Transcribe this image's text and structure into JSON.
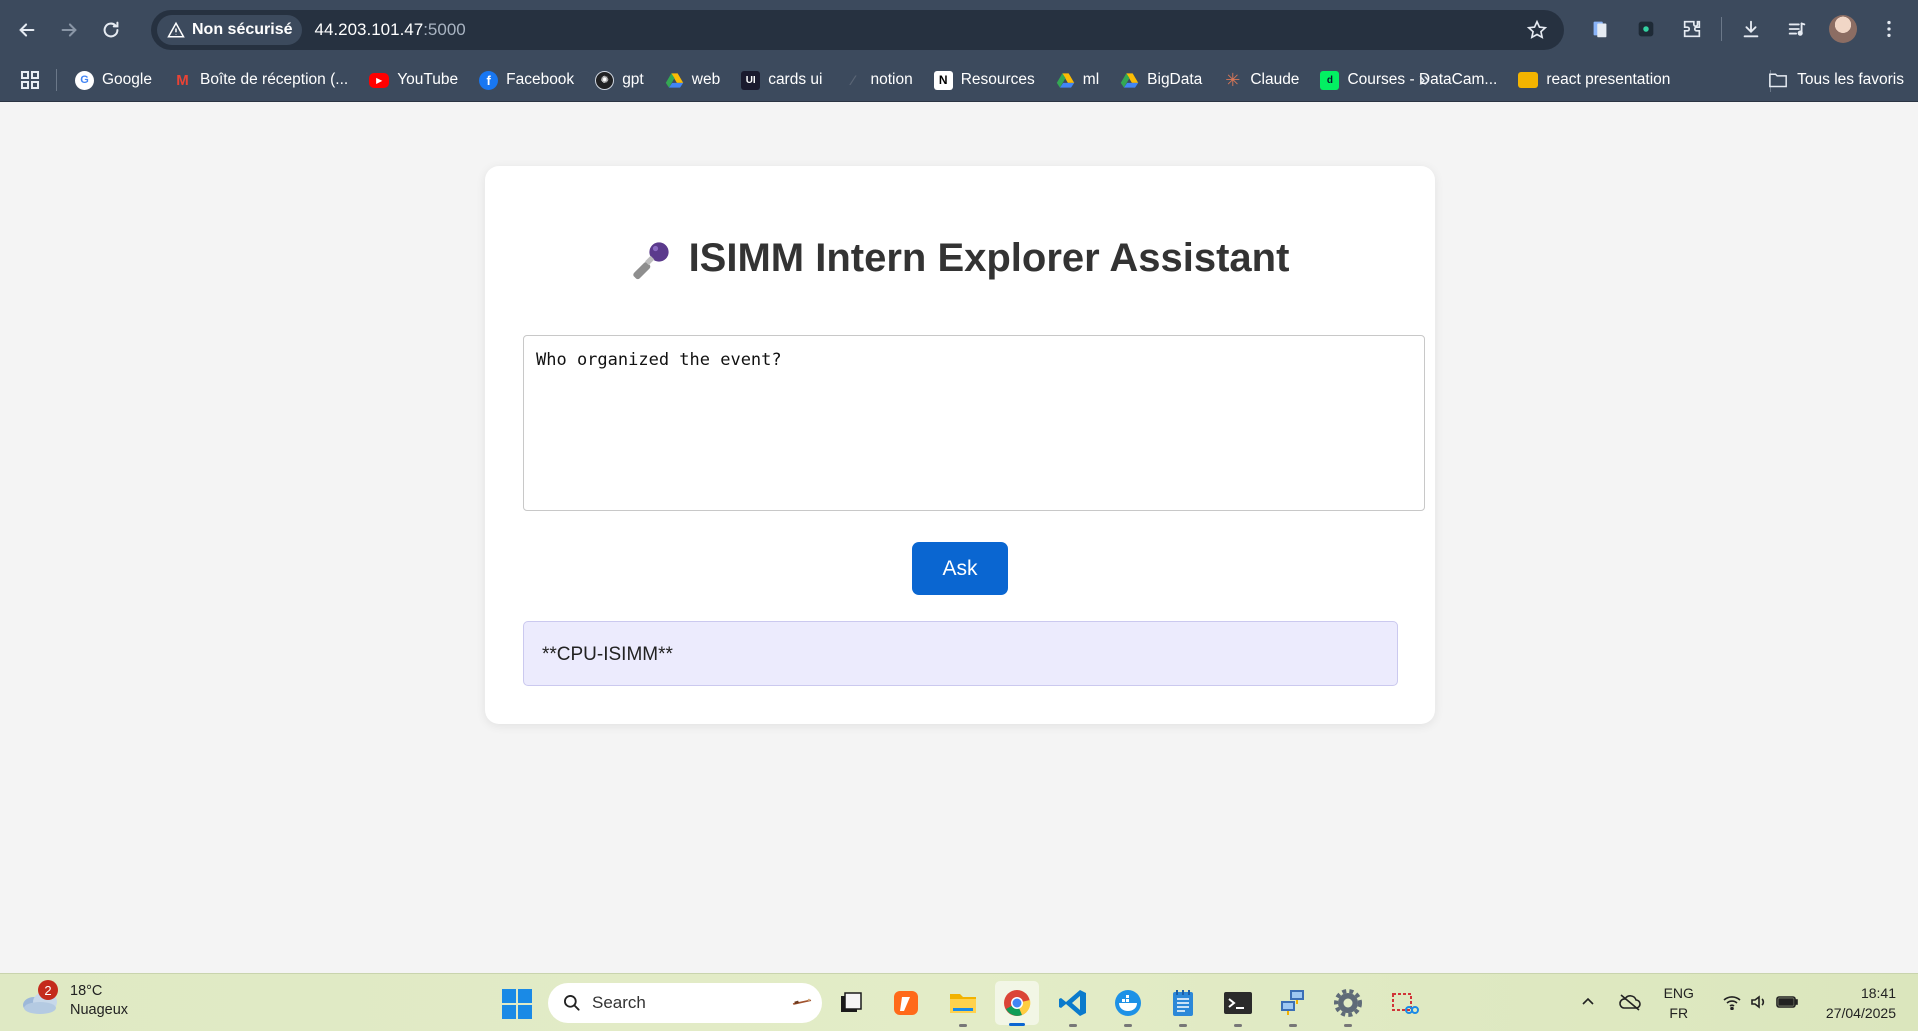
{
  "browser": {
    "security_label": "Non sécurisé",
    "url_host": "44.203.101.47",
    "url_port": ":5000"
  },
  "bookmarks": {
    "items": [
      {
        "label": "Google",
        "icon": "google-icon",
        "color": "#ffffff"
      },
      {
        "label": "Boîte de réception (...",
        "icon": "gmail-icon",
        "color": "#ea4335"
      },
      {
        "label": "YouTube",
        "icon": "youtube-icon",
        "color": "#ff0000"
      },
      {
        "label": "Facebook",
        "icon": "facebook-icon",
        "color": "#1877f2"
      },
      {
        "label": "gpt",
        "icon": "openai-icon",
        "color": "#202123"
      },
      {
        "label": "web",
        "icon": "google-drive-icon",
        "color": "#34a853"
      },
      {
        "label": "cards ui",
        "icon": "uiverse-icon",
        "color": "#1a1a2e"
      },
      {
        "label": "notion",
        "icon": "notion-icon",
        "color": "#5a6575"
      },
      {
        "label": "Resources",
        "icon": "notion-icon",
        "color": "#ffffff"
      },
      {
        "label": "ml",
        "icon": "google-drive-icon",
        "color": "#34a853"
      },
      {
        "label": "BigData",
        "icon": "google-drive-icon",
        "color": "#34a853"
      },
      {
        "label": "Claude",
        "icon": "claude-icon",
        "color": "#d97757"
      },
      {
        "label": "Courses - DataCam...",
        "icon": "datacamp-icon",
        "color": "#03ef62"
      },
      {
        "label": "react presentation",
        "icon": "google-slides-icon",
        "color": "#f4b400"
      }
    ],
    "all_bookmarks_label": "Tous les favoris"
  },
  "page": {
    "title": "ISIMM Intern Explorer Assistant",
    "question_value": "Who organized the event?",
    "ask_label": "Ask",
    "answer": "**CPU-ISIMM**"
  },
  "taskbar": {
    "weather_badge": "2",
    "temperature": "18°C",
    "weather_desc": "Nuageux",
    "search_placeholder": "Search",
    "lang_primary": "ENG",
    "lang_secondary": "FR",
    "time": "18:41",
    "date": "27/04/2025"
  },
  "colors": {
    "accent": "#0a66d1",
    "answer_bg": "#ecebfd",
    "chrome_bg": "#3c4a5d"
  }
}
